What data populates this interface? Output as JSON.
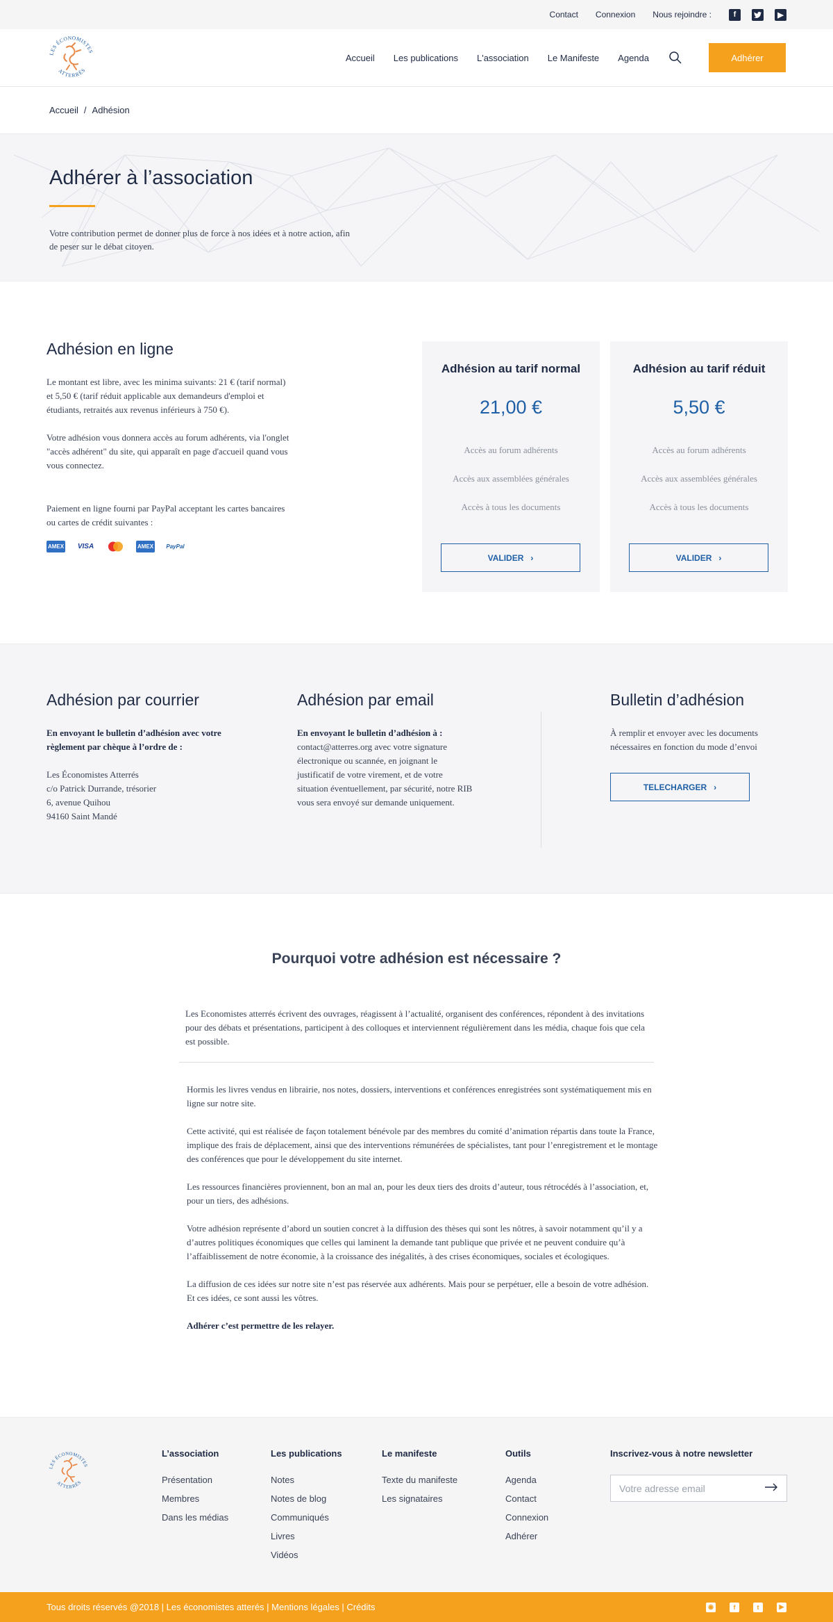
{
  "topbar": {
    "contact": "Contact",
    "connexion": "Connexion",
    "rejoindre": "Nous rejoindre :",
    "social_icons": [
      "facebook-icon",
      "twitter-icon",
      "youtube-icon"
    ]
  },
  "header": {
    "logo_text": "Les Économistes Atterrés",
    "nav": [
      "Accueil",
      "Les publications",
      "L'association",
      "Le Manifeste",
      "Agenda"
    ],
    "cta": "Adhérer"
  },
  "breadcrumb": {
    "home": "Accueil",
    "separator": "/",
    "current": "Adhésion"
  },
  "hero": {
    "title": "Adhérer à l’association",
    "text": "Votre contribution permet de donner plus de force à nos idées et à notre action, afin de peser sur le débat citoyen."
  },
  "online": {
    "title": "Adhésion en ligne",
    "p1": "Le montant est libre, avec les minima suivants: 21 € (tarif normal) et 5,50 € (tarif réduit applicable aux demandeurs d'emploi et étudiants, retraités aux revenus inférieurs à 750 €).",
    "p2": "Votre adhésion vous donnera accès au forum adhérents, via l'onglet \"accès adhérent\" du site, qui apparaît en page d'accueil quand vous vous connectez.",
    "p3": "Paiement en ligne fourni par PayPal acceptant les cartes bancaires ou cartes de crédit suivantes :",
    "payment_methods": [
      "AMEX",
      "VISA",
      "MC",
      "AMEX",
      "PayPal"
    ],
    "cards": [
      {
        "title": "Adhésion au tarif normal",
        "price": "21,00 €",
        "features": [
          "Accès au forum adhérents",
          "Accès aux assemblées générales",
          "Accès à tous les documents"
        ],
        "button": "VALIDER"
      },
      {
        "title": "Adhésion au tarif réduit",
        "price": "5,50 €",
        "features": [
          "Accès au forum adhérents",
          "Accès aux assemblées générales",
          "Accès à tous les documents"
        ],
        "button": "VALIDER"
      }
    ]
  },
  "courier": {
    "title": "Adhésion par courrier",
    "lead": "En envoyant le bulletin d’adhésion avec votre règlement par chèque à l’ordre de :",
    "address": [
      "Les Économistes Atterrés",
      "c/o Patrick Durrande, trésorier",
      "6, avenue Quihou",
      "94160 Saint Mandé"
    ]
  },
  "email": {
    "title": "Adhésion par email",
    "lead": "En envoyant le bulletin d’adhésion à :",
    "text": "contact@atterres.org avec votre signature électronique ou scannée, en joignant le justificatif de votre virement, et de votre situation éventuellement, par sécurité, notre RIB vous sera envoyé sur demande uniquement."
  },
  "bulletin": {
    "title": "Bulletin d’adhésion",
    "text": "À remplir et envoyer avec les documents nécessaires en fonction du mode d’envoi",
    "button": "TELECHARGER"
  },
  "why": {
    "title": "Pourquoi votre adhésion est nécessaire ?",
    "intro": "Les Economistes atterrés écrivent des ouvrages, réagissent à l’actualité, organisent des conférences, répondent à des invitations pour des débats et présentations, participent à des colloques et interviennent régulièrement dans les média, chaque fois que cela est possible.",
    "paragraphs": [
      "Hormis les livres vendus en librairie, nos notes, dossiers, interventions et conférences enregistrées sont systématiquement mis en ligne sur notre site.",
      "Cette activité, qui est réalisée de façon totalement bénévole par des membres du comité d’animation répartis dans toute la France, implique des frais de déplacement, ainsi que des interventions rémunérées de spécialistes, tant pour l’enregistrement et le montage des conférences que pour le développement du site internet.",
      "Les ressources financières proviennent, bon an mal an, pour les deux tiers des droits d’auteur, tous rétrocédés à l’association, et, pour un tiers, des adhésions.",
      "Votre adhésion représente d’abord un soutien concret à la diffusion des thèses qui sont les nôtres, à savoir notamment qu’il y a d’autres politiques économiques que celles qui laminent la demande tant publique que privée et ne peuvent conduire qu’à l’affaiblissement de notre économie, à la croissance des inégalités, à des crises économiques, sociales et écologiques.",
      "La diffusion de ces idées sur notre site n’est pas réservée aux adhérents. Mais pour se perpétuer, elle a besoin de votre adhésion. Et ces idées, ce sont aussi les vôtres."
    ],
    "closing": "Adhérer c’est permettre de les relayer."
  },
  "footer": {
    "columns": [
      {
        "title": "L’association",
        "items": [
          "Présentation",
          "Membres",
          "Dans les médias"
        ]
      },
      {
        "title": "Les publications",
        "items": [
          "Notes",
          "Notes de blog",
          "Communiqués",
          "Livres",
          "Vidéos"
        ]
      },
      {
        "title": "Le manifeste",
        "items": [
          "Texte du manifeste",
          "Les signataires"
        ]
      },
      {
        "title": "Outils",
        "items": [
          "Agenda",
          "Contact",
          "Connexion",
          "Adhérer"
        ]
      }
    ],
    "newsletter": {
      "title": "Inscrivez-vous à notre newsletter",
      "placeholder": "Votre adresse email"
    },
    "bottom": "Tous droits réservés @2018 | Les économistes atterés | Mentions légales | Crédits",
    "bottom_icons": [
      "rss-icon",
      "facebook-icon",
      "twitter-icon",
      "youtube-icon"
    ]
  },
  "colors": {
    "accent": "#f5a11e",
    "primary": "#1f5fa6",
    "text": "#1f2a44"
  }
}
